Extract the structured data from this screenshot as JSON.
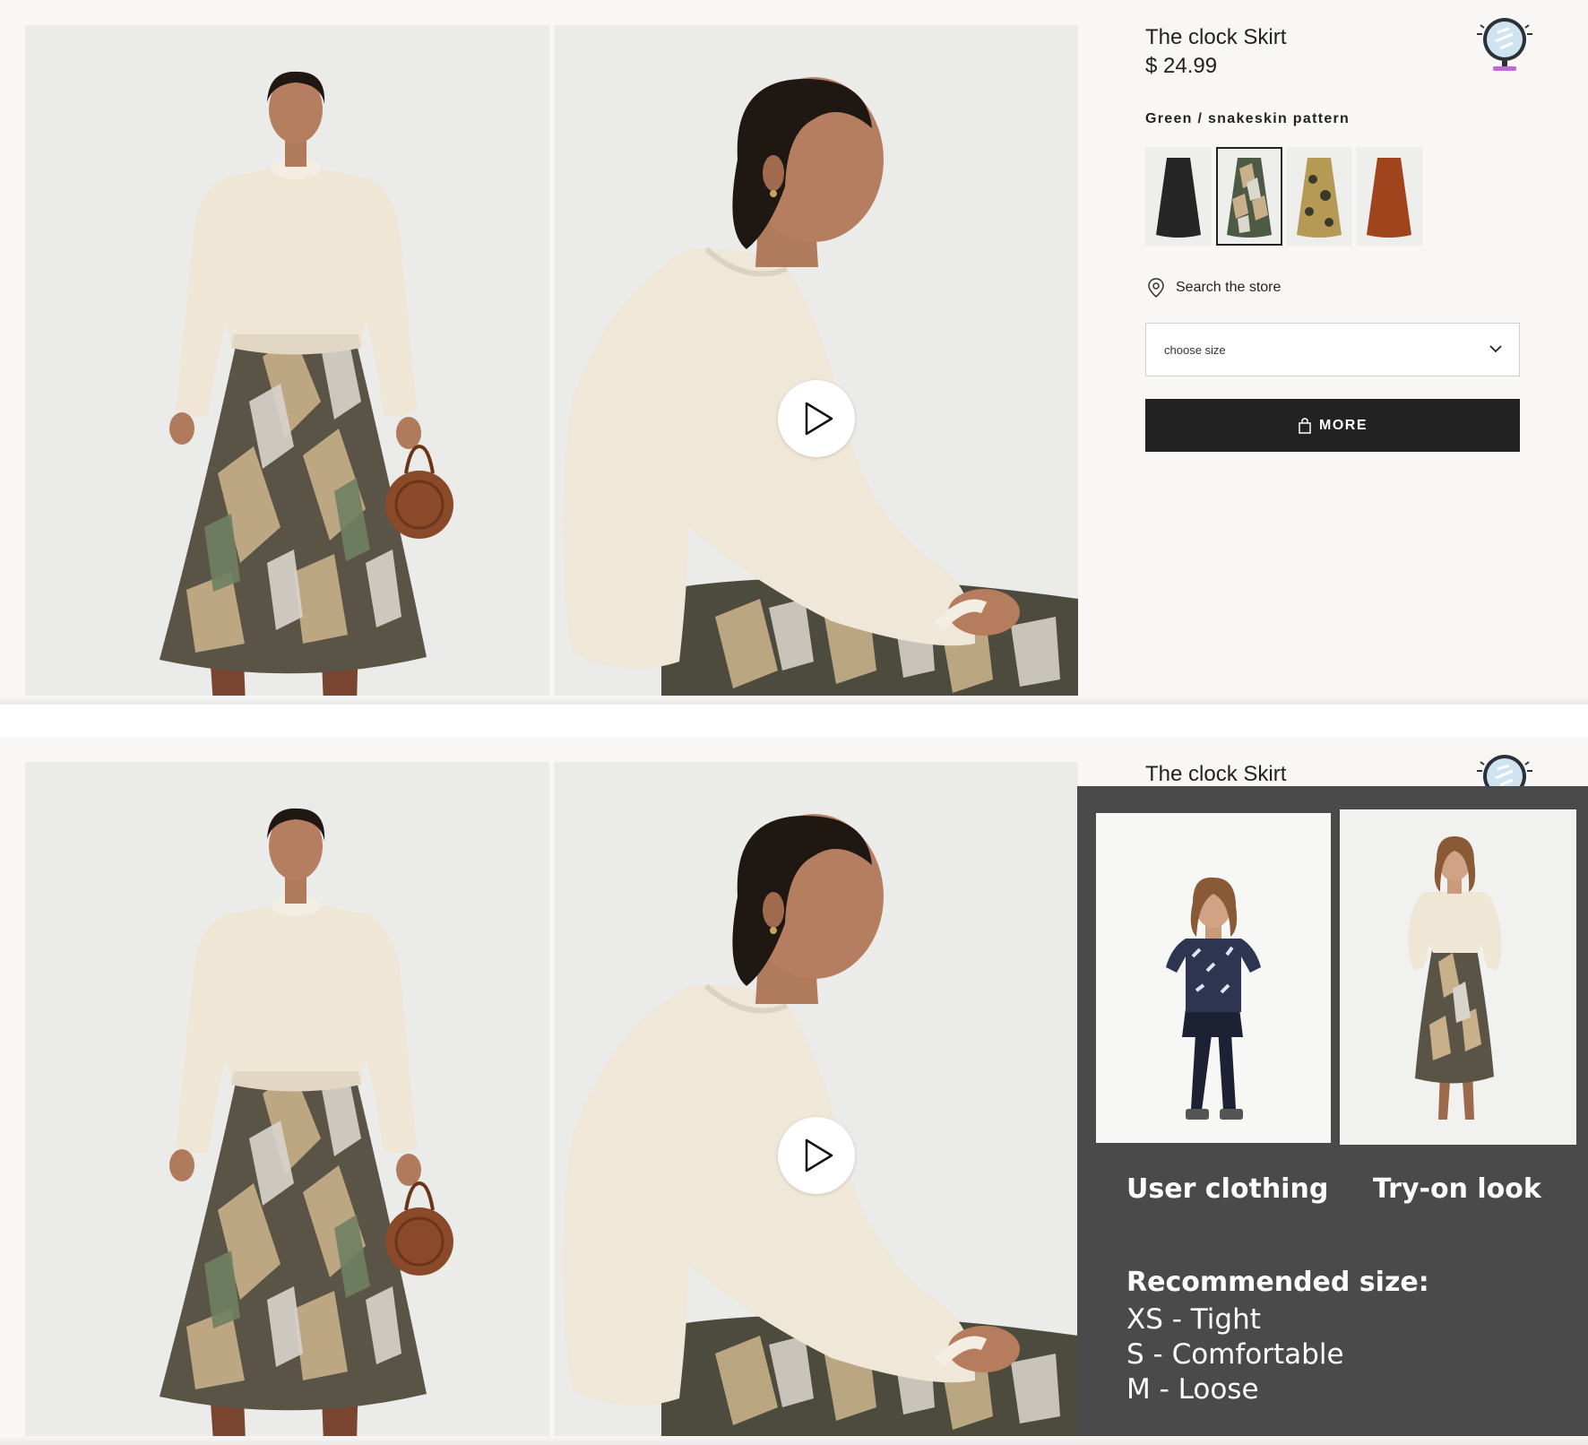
{
  "product": {
    "title": "The clock Skirt",
    "price": "$ 24.99",
    "color_name": "Green / snakeskin pattern",
    "swatches": [
      "black",
      "green-snakeskin",
      "yellow-floral",
      "rust"
    ],
    "selected_swatch": "green-snakeskin",
    "store_search_label": "Search the store",
    "size_placeholder": "choose size",
    "more_button_label": "MORE"
  },
  "media": {
    "photos": [
      "full-length model photo",
      "seated model photo with video"
    ],
    "play_icon": "play-icon"
  },
  "icons": {
    "mirror": "mirror-icon",
    "pin": "location-pin-icon",
    "bag": "shopping-bag-icon",
    "chevron": "chevron-down-icon"
  },
  "tryon_overlay": {
    "user_caption": "User clothing",
    "look_caption": "Try-on look",
    "recommended_title": "Recommended size:",
    "sizes": [
      "XS - Tight",
      "S - Comfortable",
      "M - Loose"
    ]
  },
  "colors": {
    "page_bg": "#f8f7f5",
    "button_bg": "#222222",
    "overlay_bg": "#4a4a4a",
    "mirror_accent": "#c06ad6"
  }
}
